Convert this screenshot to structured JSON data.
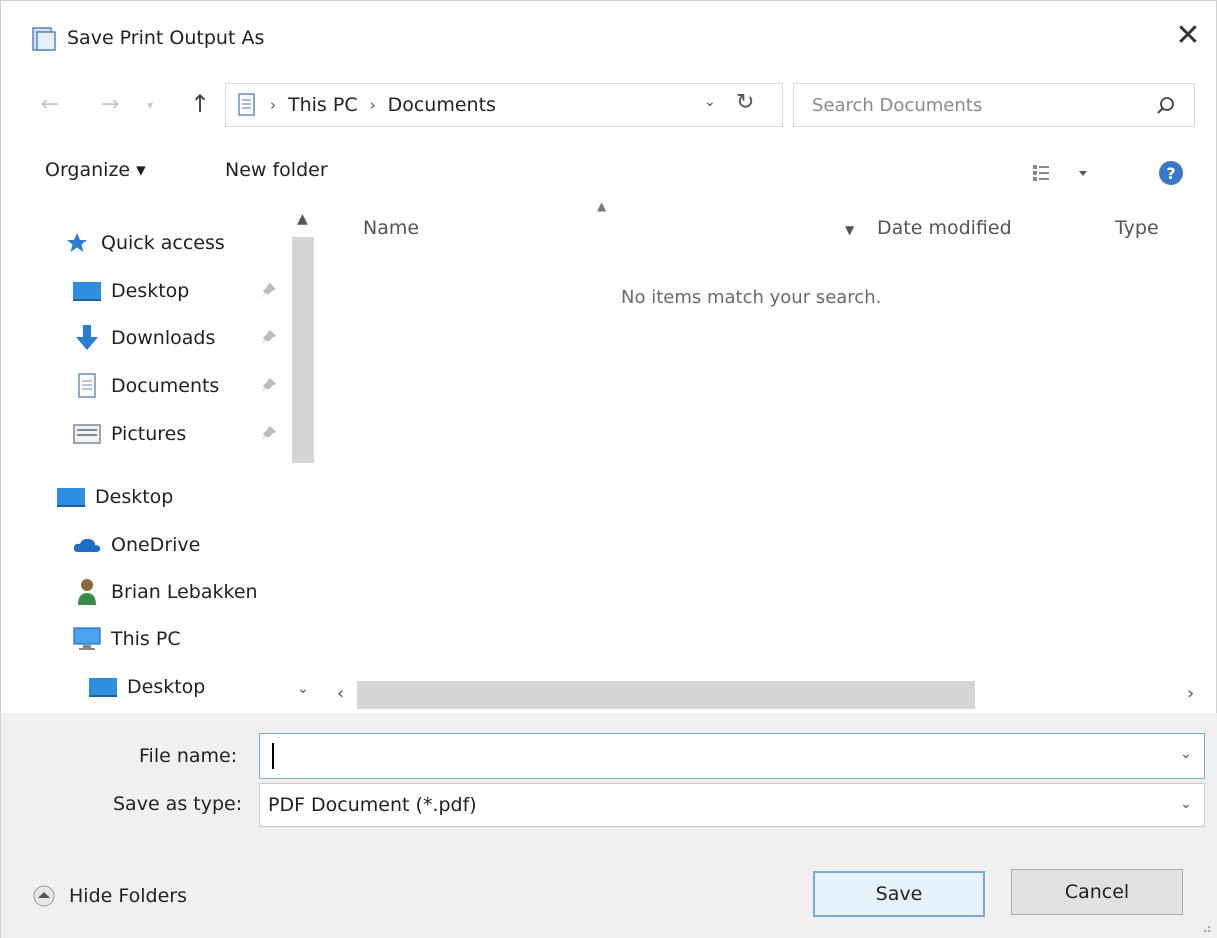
{
  "window": {
    "title": "Save Print Output As",
    "icon": "document-icon"
  },
  "navigation": {
    "back_icon": "back-arrow-icon",
    "forward_icon": "forward-arrow-icon",
    "recent_icon": "recent-locations-chevron-icon",
    "up_icon": "up-arrow-icon"
  },
  "address_bar": {
    "breadcrumbs": [
      "This PC",
      "Documents"
    ],
    "dropdown_icon": "chevron-down-icon",
    "refresh_icon": "refresh-icon"
  },
  "search": {
    "placeholder": "Search Documents",
    "value": ""
  },
  "toolbar": {
    "organize_label": "Organize ▾",
    "new_folder_label": "New folder",
    "view_icon": "view-options-icon",
    "help_icon": "help-icon"
  },
  "sidebar": {
    "items": [
      {
        "label": "Quick access",
        "icon": "star-icon"
      },
      {
        "label": "Desktop",
        "icon": "desktop-icon",
        "pinned": true
      },
      {
        "label": "Downloads",
        "icon": "download-icon",
        "pinned": true
      },
      {
        "label": "Documents",
        "icon": "documents-icon",
        "pinned": true
      },
      {
        "label": "Pictures",
        "icon": "pictures-icon",
        "pinned": true
      },
      {
        "label": "Desktop",
        "icon": "desktop-icon"
      },
      {
        "label": "OneDrive",
        "icon": "onedrive-icon"
      },
      {
        "label": "Brian Lebakken",
        "icon": "user-icon"
      },
      {
        "label": "This PC",
        "icon": "computer-icon"
      },
      {
        "label": "Desktop",
        "icon": "desktop-icon"
      }
    ]
  },
  "file_list": {
    "columns": [
      "Name",
      "Date modified",
      "Type"
    ],
    "empty_message": "No items match your search."
  },
  "form": {
    "file_name_label": "File name:",
    "file_name_value": "",
    "save_as_type_label": "Save as type:",
    "save_as_type_value": "PDF Document (*.pdf)"
  },
  "footer": {
    "hide_folders_label": "Hide Folders",
    "save_label": "Save",
    "cancel_label": "Cancel"
  },
  "colors": {
    "accent_blue": "#2b7cd3",
    "focus_border": "#7aa7d8",
    "bottom_background": "#f0f0f0"
  }
}
